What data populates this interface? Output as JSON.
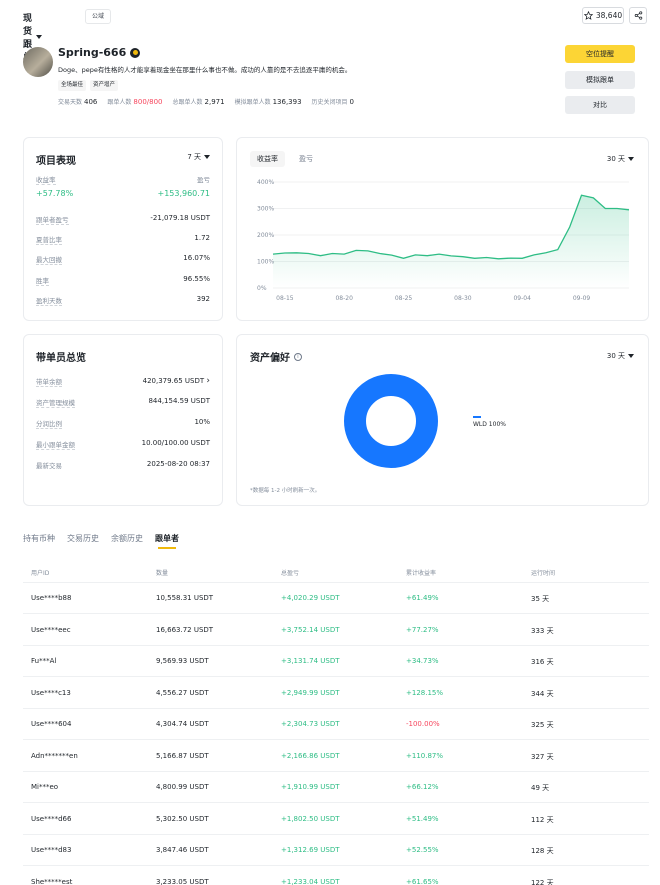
{
  "topbar": {
    "title": "现货跟单",
    "pill": "公域",
    "follow_count": "38,640"
  },
  "profile": {
    "name": "Spring-666",
    "bio": "Doge、pepe有性格的人才能享着现金坐在那里什么事也不做。成功的人靠的是不去追逐平庸的机会。",
    "tags": [
      "全场最佳",
      "资产增产"
    ],
    "stats": [
      {
        "label": "交易天数",
        "value": "406"
      },
      {
        "label": "跟单人数",
        "value": "800/800"
      },
      {
        "label": "总跟单人数",
        "value": "2,971"
      },
      {
        "label": "模拟跟单人数",
        "value": "136,393"
      },
      {
        "label": "历史关闭项目",
        "value": "0"
      }
    ]
  },
  "actions": {
    "primary": "空位提醒",
    "mock": "模拟跟单",
    "compare": "对比"
  },
  "performance": {
    "title": "项目表现",
    "period": "7 天",
    "roi_label": "收益率",
    "pnl_label": "盈亏",
    "roi_value": "+57.78%",
    "pnl_value": "+153,960.71",
    "rows": [
      {
        "k": "跟单者盈亏",
        "v": "-21,079.18 USDT"
      },
      {
        "k": "夏普比率",
        "v": "1.72"
      },
      {
        "k": "最大回撤",
        "v": "16.07%"
      },
      {
        "k": "胜率",
        "v": "96.55%"
      },
      {
        "k": "盈利天数",
        "v": "392"
      }
    ]
  },
  "chart_tabs": {
    "active": "收益率",
    "other": "盈亏",
    "period": "30 天"
  },
  "chart_data": {
    "type": "line",
    "x": [
      "08-14",
      "08-15",
      "08-16",
      "08-17",
      "08-18",
      "08-19",
      "08-20",
      "08-21",
      "08-22",
      "08-23",
      "08-24",
      "08-25",
      "08-26",
      "08-27",
      "08-28",
      "08-29",
      "08-30",
      "08-31",
      "09-01",
      "09-02",
      "09-03",
      "09-04",
      "09-05",
      "09-06",
      "09-07",
      "09-08",
      "09-09",
      "09-10",
      "09-11",
      "09-12",
      "09-13"
    ],
    "values": [
      128,
      132,
      133,
      130,
      122,
      130,
      128,
      142,
      140,
      130,
      124,
      112,
      125,
      122,
      128,
      121,
      118,
      112,
      115,
      110,
      113,
      112,
      125,
      133,
      145,
      230,
      350,
      340,
      300,
      300,
      295
    ],
    "xticks": [
      "08-15",
      "08-20",
      "08-25",
      "08-30",
      "09-04",
      "09-09"
    ],
    "yticks": [
      "0%",
      "100%",
      "200%",
      "300%",
      "400%"
    ],
    "ylim": [
      0,
      400
    ]
  },
  "leader": {
    "title": "带单员总览",
    "rows": [
      {
        "k": "带单余额",
        "v": "420,379.65 USDT"
      },
      {
        "k": "资产管理规模",
        "v": "844,154.59 USDT"
      },
      {
        "k": "分润比例",
        "v": "10%"
      },
      {
        "k": "最小跟单金额",
        "v": "10.00/100.00 USDT"
      },
      {
        "k": "最新交易",
        "v": "2025-08-20 08:37"
      }
    ]
  },
  "asset": {
    "title": "资产偏好",
    "period": "30 天",
    "legend": "WLD 100%",
    "note": "*数据每 1-2 小时刷新一次。",
    "color": "#1677ff"
  },
  "tabs": [
    "持有币种",
    "交易历史",
    "余额历史",
    "跟单者"
  ],
  "table": {
    "headers": [
      "用户ID",
      "数量",
      "总盈亏",
      "累计收益率",
      "运行时间"
    ],
    "rows": [
      [
        "Use****b88",
        "10,558.31 USDT",
        "+4,020.29 USDT",
        "+61.49%",
        "35 天"
      ],
      [
        "Use****eec",
        "16,663.72 USDT",
        "+3,752.14 USDT",
        "+77.27%",
        "333 天"
      ],
      [
        "Fu***Al",
        "9,569.93 USDT",
        "+3,131.74 USDT",
        "+34.73%",
        "316 天"
      ],
      [
        "Use****c13",
        "4,556.27 USDT",
        "+2,949.99 USDT",
        "+128.15%",
        "344 天"
      ],
      [
        "Use****604",
        "4,304.74 USDT",
        "+2,304.73 USDT",
        "-100.00%",
        "325 天"
      ],
      [
        "Adn*******en",
        "5,166.87 USDT",
        "+2,166.86 USDT",
        "+110.87%",
        "327 天"
      ],
      [
        "Mi***eo",
        "4,800.99 USDT",
        "+1,910.99 USDT",
        "+66.12%",
        "49 天"
      ],
      [
        "Use****d66",
        "5,302.50 USDT",
        "+1,802.50 USDT",
        "+51.49%",
        "112 天"
      ],
      [
        "Use****d83",
        "3,847.46 USDT",
        "+1,312.69 USDT",
        "+52.55%",
        "128 天"
      ],
      [
        "She*****est",
        "3,233.05 USDT",
        "+1,233.04 USDT",
        "+61.65%",
        "122 天"
      ]
    ]
  }
}
